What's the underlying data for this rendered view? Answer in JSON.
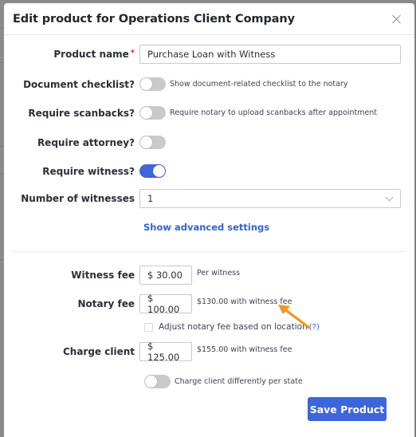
{
  "modal": {
    "title": "Edit product for Operations Client Company",
    "close_icon": "close-icon"
  },
  "form": {
    "product_name": {
      "label": "Product name",
      "required_mark": "*",
      "value": "Purchase Loan with Witness"
    },
    "document_checklist": {
      "label": "Document checklist?",
      "enabled": false,
      "hint": "Show document-related checklist to the notary"
    },
    "require_scanbacks": {
      "label": "Require scanbacks?",
      "enabled": false,
      "hint": "Require notary to upload scanbacks after appointment"
    },
    "require_attorney": {
      "label": "Require attorney?",
      "enabled": false
    },
    "require_witness": {
      "label": "Require witness?",
      "enabled": true
    },
    "number_of_witnesses": {
      "label": "Number of witnesses",
      "selected": "1"
    },
    "advanced_link": "Show advanced settings",
    "witness_fee": {
      "label": "Witness fee",
      "value": "$ 30.00",
      "note": "Per witness"
    },
    "notary_fee": {
      "label": "Notary fee",
      "value": "$ 100.00",
      "note": "$130.00 with witness fee"
    },
    "adjust_notary_fee": {
      "label": "Adjust notary fee based on location",
      "help": "(?)",
      "checked": false
    },
    "charge_client": {
      "label": "Charge client",
      "value": "$ 125.00",
      "note": "$155.00 with witness fee"
    },
    "charge_per_state": {
      "label": "Charge client differently per state",
      "enabled": false
    },
    "save_button": "Save Product"
  },
  "annotation": {
    "arrow_color": "#f7941d",
    "points_to": "notary_fee.note"
  },
  "colors": {
    "accent": "#3d66db",
    "link": "#3461d6",
    "required": "#d9342b",
    "overlay": "#8a8a8a"
  }
}
